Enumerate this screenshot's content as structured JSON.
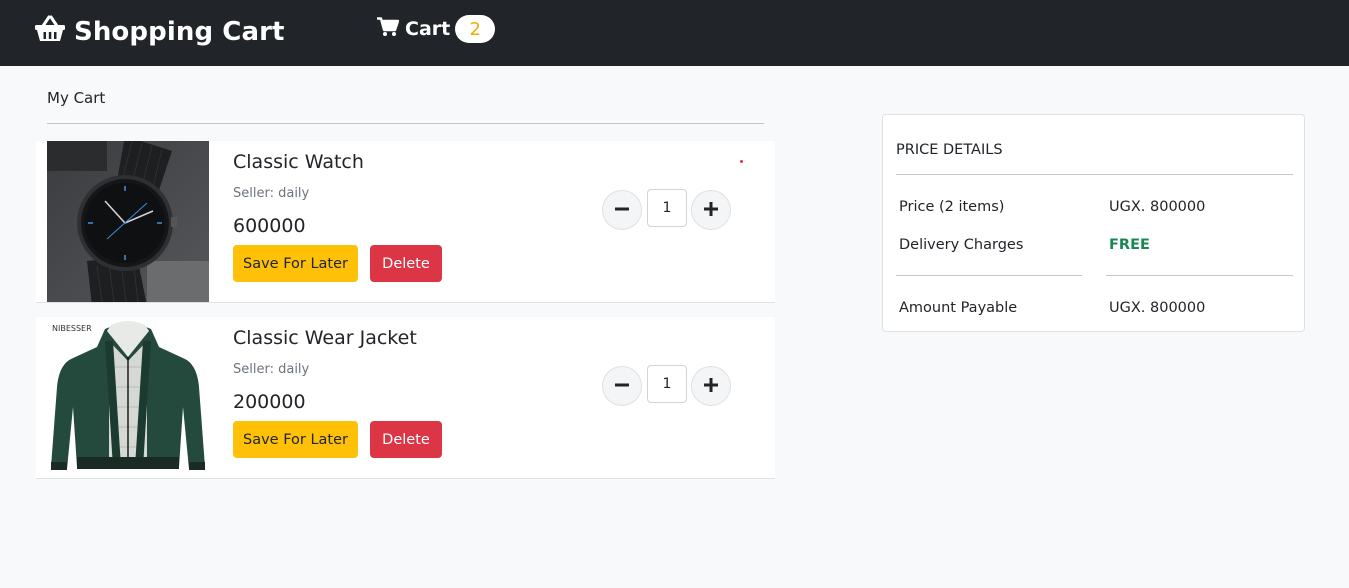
{
  "header": {
    "brand_label": "Shopping Cart",
    "brand_icon": "basket-icon",
    "cart_label": "Cart",
    "cart_icon": "cart-icon",
    "cart_count": "2"
  },
  "cart": {
    "title": "My Cart",
    "items": [
      {
        "name": "Classic Watch",
        "seller": "Seller: daily",
        "price": "600000",
        "quantity": "1",
        "save_label": "Save For Later",
        "delete_label": "Delete"
      },
      {
        "name": "Classic Wear Jacket",
        "image_brand": "NIBESSER",
        "seller": "Seller: daily",
        "price": "200000",
        "quantity": "1",
        "save_label": "Save For Later",
        "delete_label": "Delete"
      }
    ]
  },
  "price_details": {
    "heading": "PRICE DETAILS",
    "price_label": "Price (2 items)",
    "price_value": "UGX. 800000",
    "delivery_label": "Delivery Charges",
    "delivery_value": "FREE",
    "payable_label": "Amount Payable",
    "payable_value": "UGX. 800000"
  },
  "colors": {
    "navbar": "#212529",
    "save_button": "#ffc107",
    "delete_button": "#dc3545",
    "free_text": "#198754",
    "badge_text": "#f0ad00"
  }
}
